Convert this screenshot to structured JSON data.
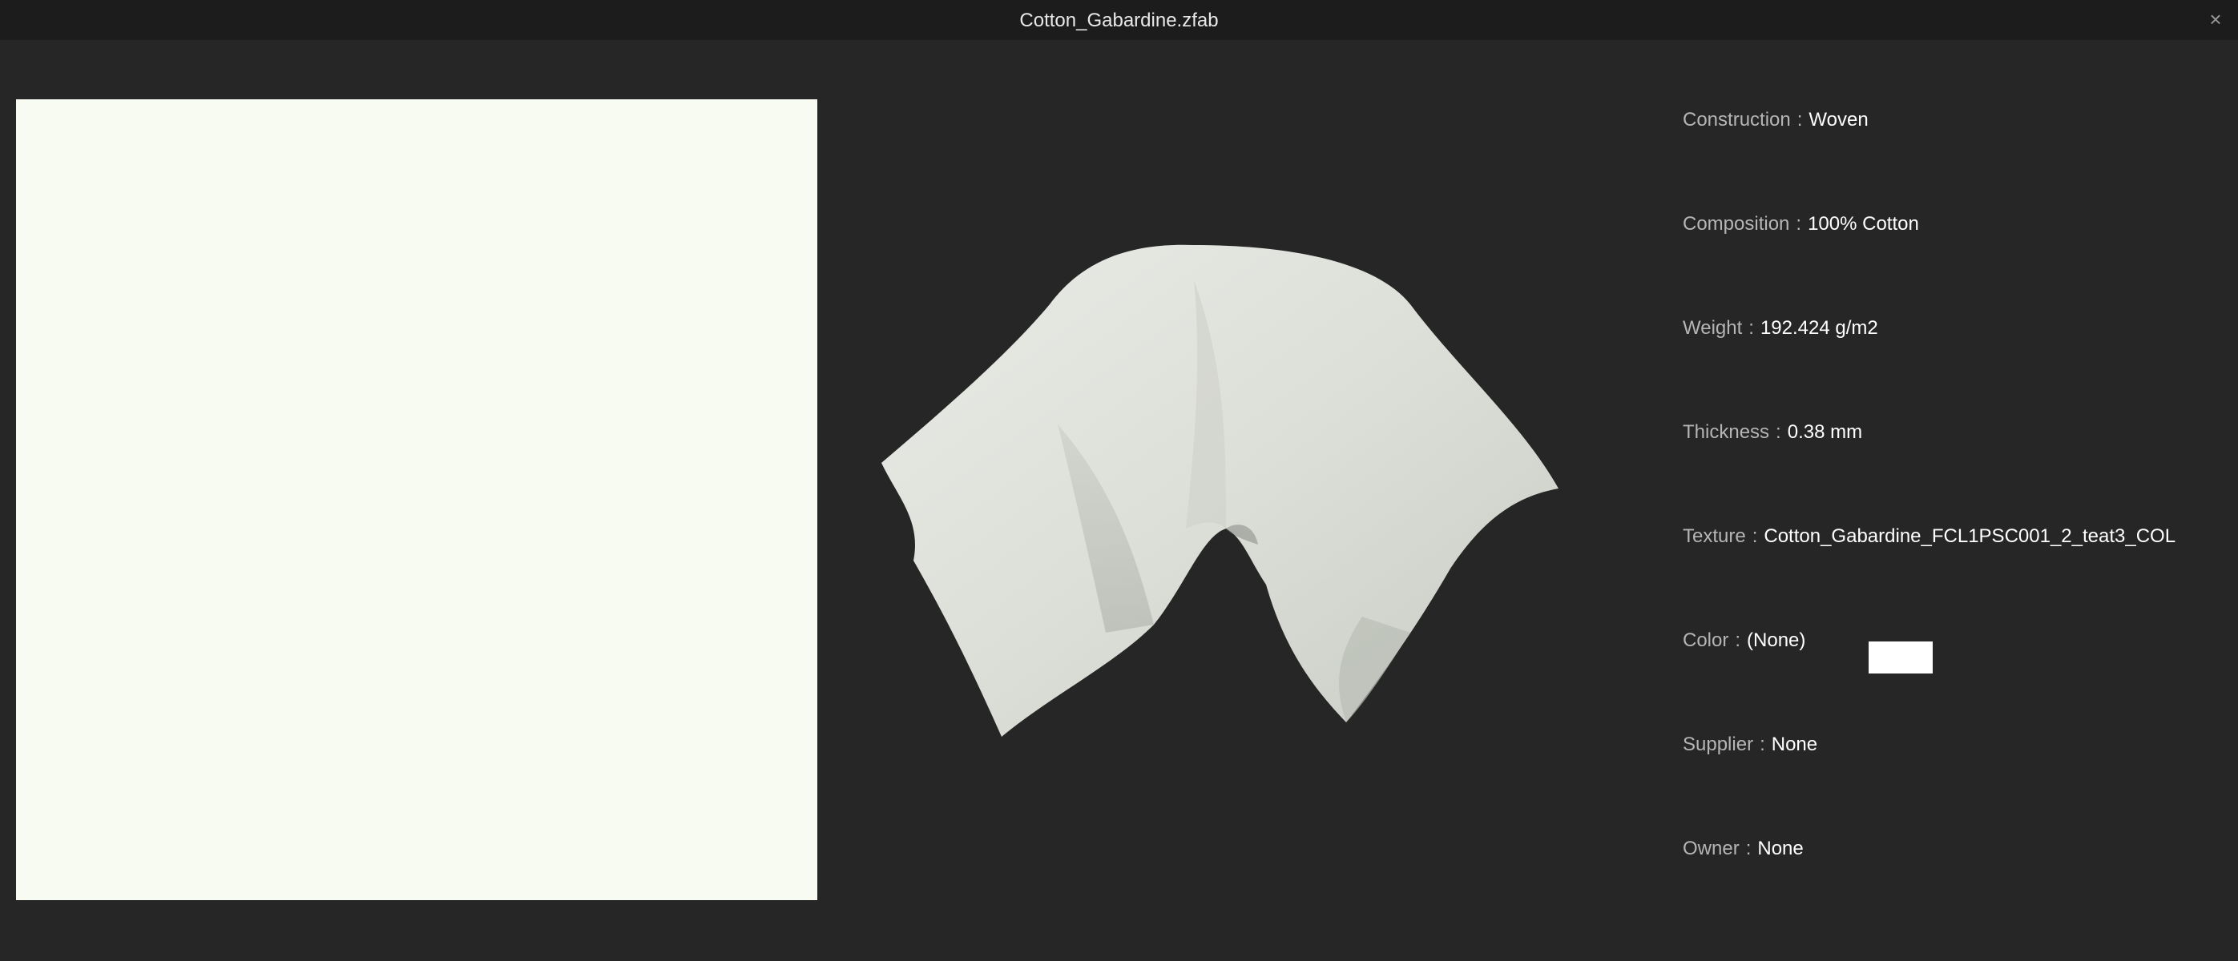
{
  "window": {
    "title": "Cotton_Gabardine.zfab",
    "close_glyph": "×"
  },
  "texture_preview": {
    "swatch_color": "#f7fbf2"
  },
  "fabric_preview": {
    "icon": "draped-fabric-3d"
  },
  "properties": {
    "separator": ":",
    "construction": {
      "label": "Construction",
      "value": "Woven"
    },
    "composition": {
      "label": "Composition",
      "value": "100% Cotton"
    },
    "weight": {
      "label": "Weight",
      "value": "192.424 g/m2"
    },
    "thickness": {
      "label": "Thickness",
      "value": "0.38 mm"
    },
    "texture": {
      "label": "Texture",
      "value": "Cotton_Gabardine_FCL1PSC001_2_teat3_COL"
    },
    "color": {
      "label": "Color",
      "value": "(None)",
      "chip_color": "#ffffff"
    },
    "supplier": {
      "label": "Supplier",
      "value": "None"
    },
    "owner": {
      "label": "Owner",
      "value": "None"
    }
  }
}
